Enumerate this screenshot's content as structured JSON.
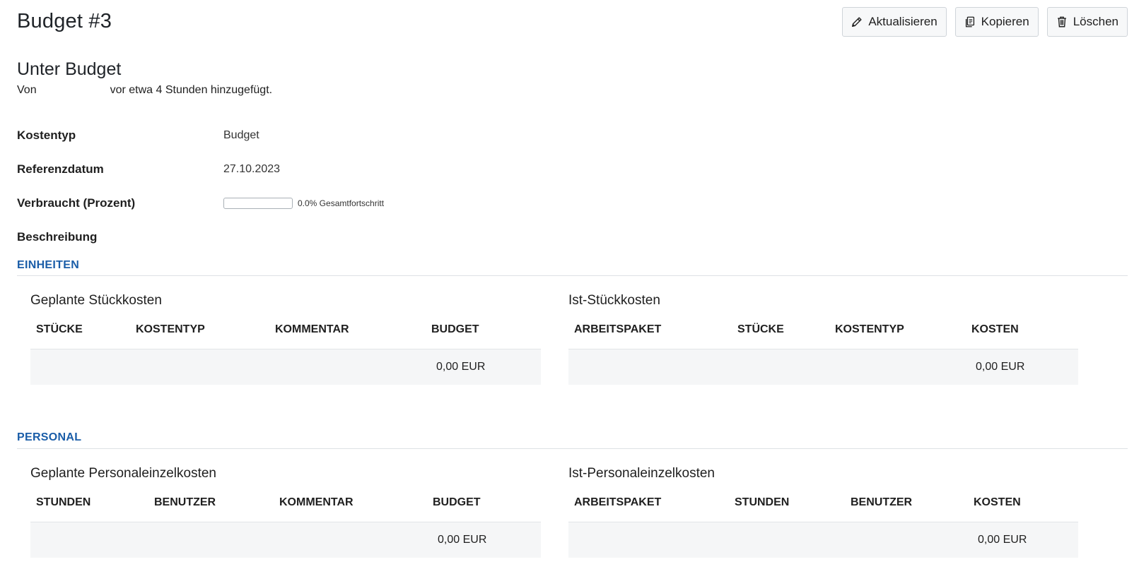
{
  "page": {
    "title": "Budget #3",
    "subtitle": "Unter Budget",
    "author_prefix": "Von",
    "author_suffix": "vor etwa 4 Stunden hinzugefügt."
  },
  "toolbar": {
    "update_label": "Aktualisieren",
    "copy_label": "Kopieren",
    "delete_label": "Löschen"
  },
  "attributes": {
    "cost_type_label": "Kostentyp",
    "cost_type_value": "Budget",
    "reference_date_label": "Referenzdatum",
    "reference_date_value": "27.10.2023",
    "spent_label": "Verbraucht (Prozent)",
    "spent_progress": 0.0,
    "spent_text": "0.0% Gesamtfortschritt",
    "description_label": "Beschreibung"
  },
  "units": {
    "section_title": "EINHEITEN",
    "planned": {
      "heading": "Geplante Stückkosten",
      "columns": [
        "Stücke",
        "Kostentyp",
        "Kommentar",
        "Budget"
      ],
      "total": "0,00 EUR"
    },
    "actual": {
      "heading": "Ist-Stückkosten",
      "columns": [
        "Arbeitspaket",
        "Stücke",
        "Kostentyp",
        "Kosten"
      ],
      "total": "0,00 EUR"
    }
  },
  "personnel": {
    "section_title": "PERSONAL",
    "planned": {
      "heading": "Geplante Personaleinzelkosten",
      "columns": [
        "Stunden",
        "Benutzer",
        "Kommentar",
        "Budget"
      ],
      "total": "0,00 EUR"
    },
    "actual": {
      "heading": "Ist-Personaleinzelkosten",
      "columns": [
        "Arbeitspaket",
        "Stunden",
        "Benutzer",
        "Kosten"
      ],
      "total": "0,00 EUR"
    }
  }
}
